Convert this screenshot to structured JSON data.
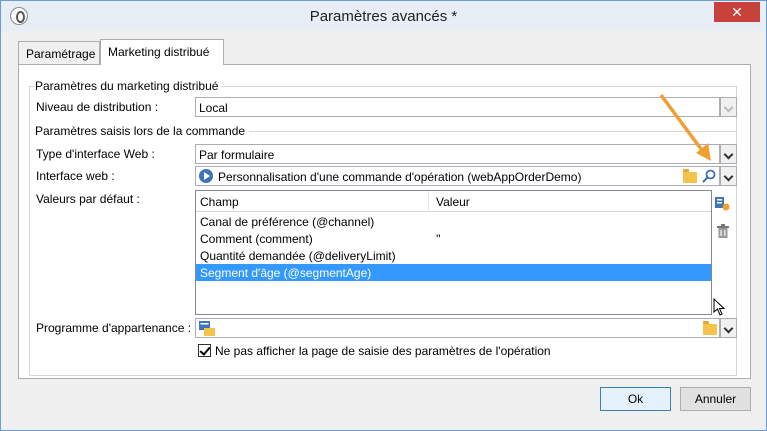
{
  "window": {
    "title": "Paramètres avancés *",
    "close_glyph": "✕"
  },
  "tabs": [
    {
      "label": "Paramétrage",
      "active": false
    },
    {
      "label": "Marketing distribué",
      "active": true
    }
  ],
  "section1": {
    "title": "Paramètres du marketing distribué",
    "distribution_label": "Niveau de distribution :",
    "distribution_value": "Local"
  },
  "section2": {
    "title": "Paramètres saisis lors de la commande",
    "web_interface_type_label": "Type d'interface Web :",
    "web_interface_type_value": "Par formulaire",
    "web_interface_label": "Interface web :",
    "web_interface_value": "Personnalisation d'une commande d'opération (webAppOrderDemo)",
    "defaults_label": "Valeurs par défaut :",
    "table": {
      "columns": [
        "Champ",
        "Valeur"
      ],
      "rows": [
        {
          "field": "Canal de préférence (@channel)",
          "value": ""
        },
        {
          "field": "Comment (comment)",
          "value": "''"
        },
        {
          "field": "Quantité demandée (@deliveryLimit)",
          "value": ""
        },
        {
          "field": "Segment d'âge (@segmentAge)",
          "value": "",
          "selected": true
        }
      ]
    },
    "appearance_label": "Programme d'appartenance :",
    "appearance_value": "",
    "checkbox_label": "Ne pas afficher la page de saisie des paramètres de l'opération",
    "checkbox_checked": true
  },
  "buttons": {
    "ok": "Ok",
    "cancel": "Annuler"
  },
  "colors": {
    "selection": "#3399ff",
    "arrow": "#f0a030",
    "folder": "#f5c24c"
  }
}
